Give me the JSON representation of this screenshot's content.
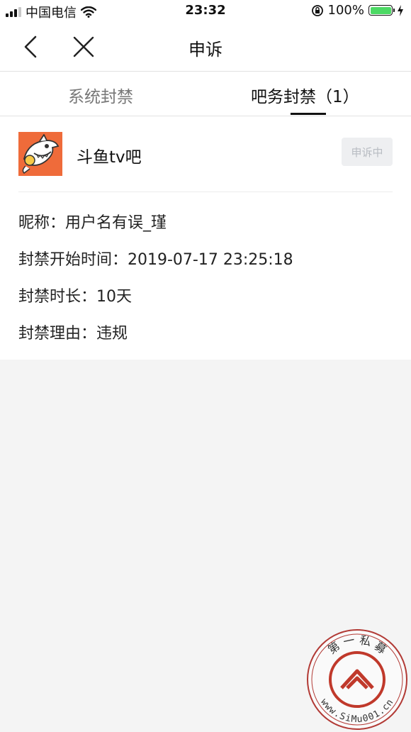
{
  "status_bar": {
    "carrier": "中国电信",
    "time": "23:32",
    "battery": "100%"
  },
  "nav": {
    "title": "申诉"
  },
  "tabs": [
    {
      "label": "系统封禁",
      "active": false
    },
    {
      "label": "吧务封禁（1）",
      "active": true
    }
  ],
  "ban_record": {
    "forum_name": "斗鱼tv吧",
    "status_label": "申诉中",
    "nickname": "昵称：用户名有误_瑾",
    "start_time": "封禁开始时间：2019-07-17 23:25:18",
    "duration": "封禁时长：10天",
    "reason": "封禁理由：违规"
  },
  "watermark": {
    "top_text": "第 一 私 募",
    "ring_text": "www.SiMu001.cn"
  },
  "colors": {
    "accent_orange": "#ef6b3a",
    "battery_green": "#4cd964",
    "watermark_red": "#c0392b"
  },
  "icons": [
    "back-arrow-icon",
    "close-icon",
    "wifi-icon",
    "rotation-lock-icon",
    "charging-icon"
  ]
}
